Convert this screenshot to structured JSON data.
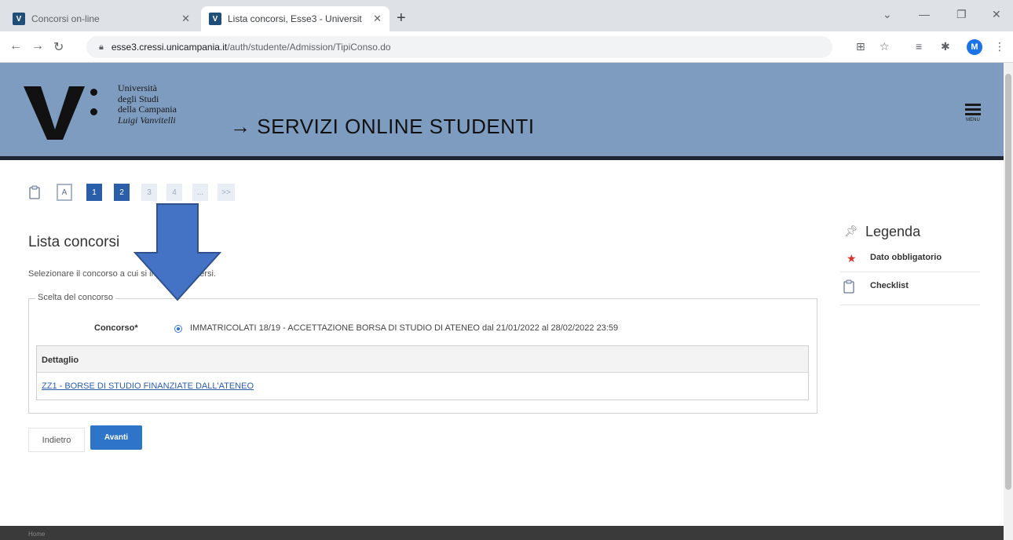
{
  "browser": {
    "tabs": [
      {
        "title": "Concorsi on-line",
        "favicon": "V"
      },
      {
        "title": "Lista concorsi, Esse3 - Universit",
        "favicon": "V"
      }
    ],
    "new_tab": "+",
    "url_host": "esse3.cressi.unicampania.it",
    "url_path": "/auth/studente/Admission/TipiConso.do"
  },
  "header": {
    "uni_line1": "Università",
    "uni_line2": "degli Studi",
    "uni_line3": "della Campania",
    "uni_line4": "Luigi Vanvitelli",
    "portal_title": "→ SERVIZI ONLINE STUDENTI",
    "menu_label": "MENU"
  },
  "pagination": {
    "items": [
      "A",
      "1",
      "2",
      "3",
      "4",
      "...",
      ">>"
    ]
  },
  "main": {
    "title": "Lista concorsi",
    "instruction": "Selezionare il concorso a cui si intende iscriversi.",
    "fieldset_legend": "Scelta del concorso",
    "concorso_label": "Concorso*",
    "concorso_option": "IMMATRICOLATI 18/19 - ACCETTAZIONE BORSA DI STUDIO DI ATENEO dal 21/01/2022 al 28/02/2022 23:59",
    "detail_header": "Dettaglio",
    "detail_link": "ZZ1 - BORSE DI STUDIO FINANZIATE DALL'ATENEO",
    "back_button": "Indietro",
    "next_button": "Avanti"
  },
  "legend": {
    "title": "Legenda",
    "item1": "Dato obbligatorio",
    "item2": "Checklist"
  },
  "footer": {
    "text": "Home"
  },
  "colors": {
    "header_bg": "#7e9cbf",
    "page_active": "#2b5ea8",
    "button_primary": "#2e74c8",
    "annotation_arrow": "#4472c4",
    "required_star": "#d9342b"
  }
}
